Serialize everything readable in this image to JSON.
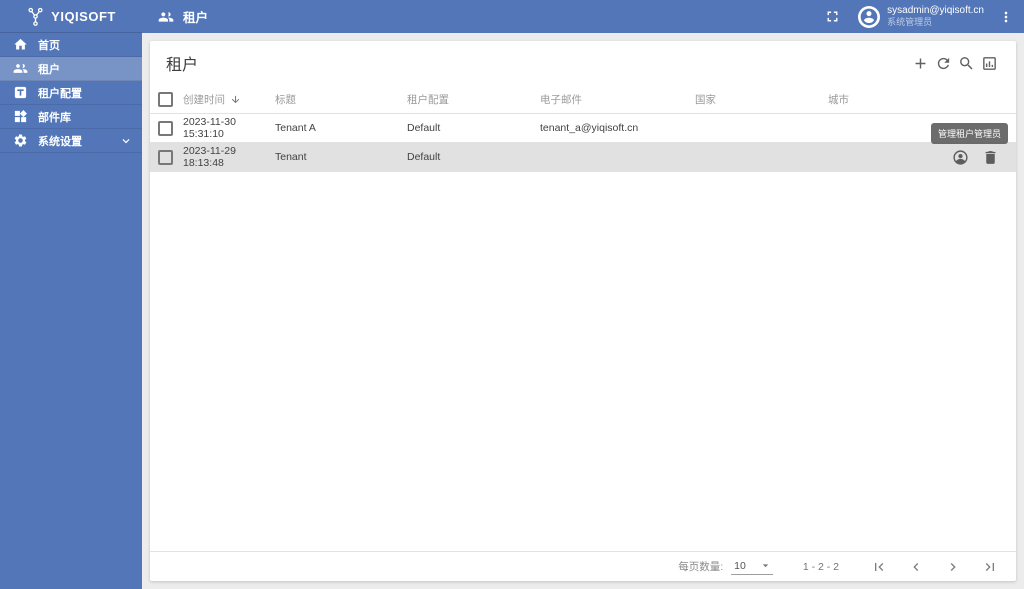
{
  "brand": {
    "name": "YIQISOFT"
  },
  "sidebar": {
    "items": [
      {
        "label": "首页",
        "icon": "home-icon",
        "active": false
      },
      {
        "label": "租户",
        "icon": "people-icon",
        "active": true
      },
      {
        "label": "租户配置",
        "icon": "tenant-config-icon",
        "active": false
      },
      {
        "label": "部件库",
        "icon": "widgets-icon",
        "active": false
      },
      {
        "label": "系统设置",
        "icon": "gear-icon",
        "active": false,
        "expandable": true
      }
    ]
  },
  "topbar": {
    "title": "租户",
    "user": {
      "email": "sysadmin@yiqisoft.cn",
      "role": "系统管理员"
    }
  },
  "page": {
    "title": "租户",
    "toolbar_icons": [
      "add-icon",
      "refresh-icon",
      "search-icon",
      "chart-box-icon"
    ]
  },
  "table": {
    "columns": {
      "created": "创建时间",
      "title": "标题",
      "config": "租户配置",
      "email": "电子邮件",
      "country": "国家",
      "city": "城市"
    },
    "rows": [
      {
        "created": "2023-11-30 15:31:10",
        "title": "Tenant A",
        "config": "Default",
        "email": "tenant_a@yiqisoft.cn",
        "country": "",
        "city": ""
      },
      {
        "created": "2023-11-29 18:13:48",
        "title": "Tenant",
        "config": "Default",
        "email": "",
        "country": "",
        "city": ""
      }
    ],
    "row_action_tooltip": "管理租户管理员",
    "row_action_icons": [
      "manage-admin-icon",
      "delete-icon"
    ]
  },
  "footer": {
    "per_page_label": "每页数量:",
    "per_page_value": "10",
    "range_text": "1 - 2 - 2",
    "pager_icons": [
      "first-page-icon",
      "prev-page-icon",
      "next-page-icon",
      "last-page-icon"
    ]
  },
  "colors": {
    "accent": "#5276b8",
    "selected_row": "#e1e1e1",
    "tooltip_bg": "#616161"
  }
}
